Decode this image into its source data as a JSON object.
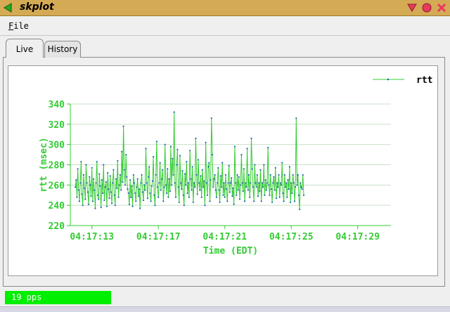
{
  "window": {
    "title": "skplot"
  },
  "menu": {
    "file_label": "File"
  },
  "tabs": [
    {
      "label": "Live",
      "active": true
    },
    {
      "label": "History",
      "active": false
    }
  ],
  "status": {
    "text": "19 pps",
    "color": "#00ee00"
  },
  "colors": {
    "titlebar": "#d4aa55",
    "plot_line": "#33cc33",
    "plot_marker": "#2266aa",
    "axis": "#33cc33",
    "grid": "#c9e0c9"
  },
  "icons": {
    "title_arrow": "left-arrow-icon",
    "minimize": "minimize-icon",
    "maximize": "maximize-icon",
    "close": "close-icon"
  },
  "chart_data": {
    "type": "line",
    "xlabel": "Time (EDT)",
    "ylabel": "rtt (msec)",
    "ylim": [
      220,
      340
    ],
    "yticks": [
      220,
      240,
      260,
      280,
      300,
      320,
      340
    ],
    "xlim_seconds": [
      11.7,
      31.0
    ],
    "xtick_labels": [
      "04:17:13",
      "04:17:17",
      "04:17:21",
      "04:17:25",
      "04:17:29"
    ],
    "xtick_seconds": [
      13,
      17,
      21,
      25,
      29
    ],
    "grid": true,
    "legend_position": "top-right",
    "series": [
      {
        "name": "rtt",
        "x_seconds_step": 0.05,
        "x_seconds_start": 12.0,
        "values": [
          258,
          265,
          248,
          276,
          255,
          244,
          262,
          283,
          251,
          240,
          270,
          257,
          246,
          280,
          262,
          253,
          241,
          268,
          260,
          249,
          277,
          244,
          266,
          255,
          237,
          262,
          283,
          250,
          246,
          271,
          259,
          238,
          265,
          252,
          280,
          245,
          258,
          263,
          239,
          272,
          256,
          247,
          269,
          253,
          242,
          262,
          275,
          250,
          240,
          266,
          257,
          284,
          248,
          260,
          270,
          255,
          293,
          263,
          318,
          275,
          260,
          290,
          268,
          256,
          252,
          241,
          265,
          248,
          259,
          239,
          270,
          262,
          252,
          244,
          258,
          266,
          249,
          256,
          237,
          262,
          270,
          253,
          245,
          260,
          255,
          296,
          262,
          247,
          268,
          278,
          252,
          244,
          259,
          264,
          288,
          250,
          240,
          270,
          303,
          258,
          248,
          262,
          282,
          255,
          266,
          275,
          244,
          258,
          300,
          260,
          252,
          276,
          248,
          266,
          254,
          298,
          260,
          286,
          270,
          332,
          262,
          248,
          280,
          295,
          258,
          243,
          289,
          262,
          256,
          274,
          250,
          240,
          271,
          260,
          283,
          252,
          262,
          248,
          294,
          266,
          255,
          278,
          243,
          262,
          258,
          306,
          270,
          251,
          285,
          262,
          255,
          269,
          248,
          275,
          258,
          264,
          240,
          302,
          262,
          250,
          278,
          282,
          244,
          265,
          326,
          290,
          258,
          266,
          270,
          255,
          248,
          262,
          277,
          255,
          243,
          269,
          258,
          282,
          250,
          262,
          248,
          270,
          256,
          244,
          262,
          279,
          253,
          262,
          267,
          249,
          257,
          241,
          298,
          262,
          250,
          270,
          255,
          268,
          246,
          260,
          290,
          262,
          254,
          276,
          244,
          262,
          258,
          296,
          255,
          270,
          248,
          262,
          306,
          276,
          258,
          244,
          280,
          262,
          258,
          270,
          249,
          262,
          254,
          275,
          244,
          262,
          258,
          280,
          250,
          265,
          255,
          262,
          297,
          260,
          250,
          270,
          256,
          243,
          262,
          268,
          255,
          277,
          247,
          262,
          258,
          270,
          248,
          262,
          260,
          282,
          252,
          244,
          270,
          258,
          262,
          248,
          265,
          256,
          278,
          243,
          262,
          252,
          270,
          262,
          244,
          258,
          326,
          260,
          270,
          250,
          236,
          262,
          258,
          256,
          270,
          250
        ]
      }
    ]
  }
}
